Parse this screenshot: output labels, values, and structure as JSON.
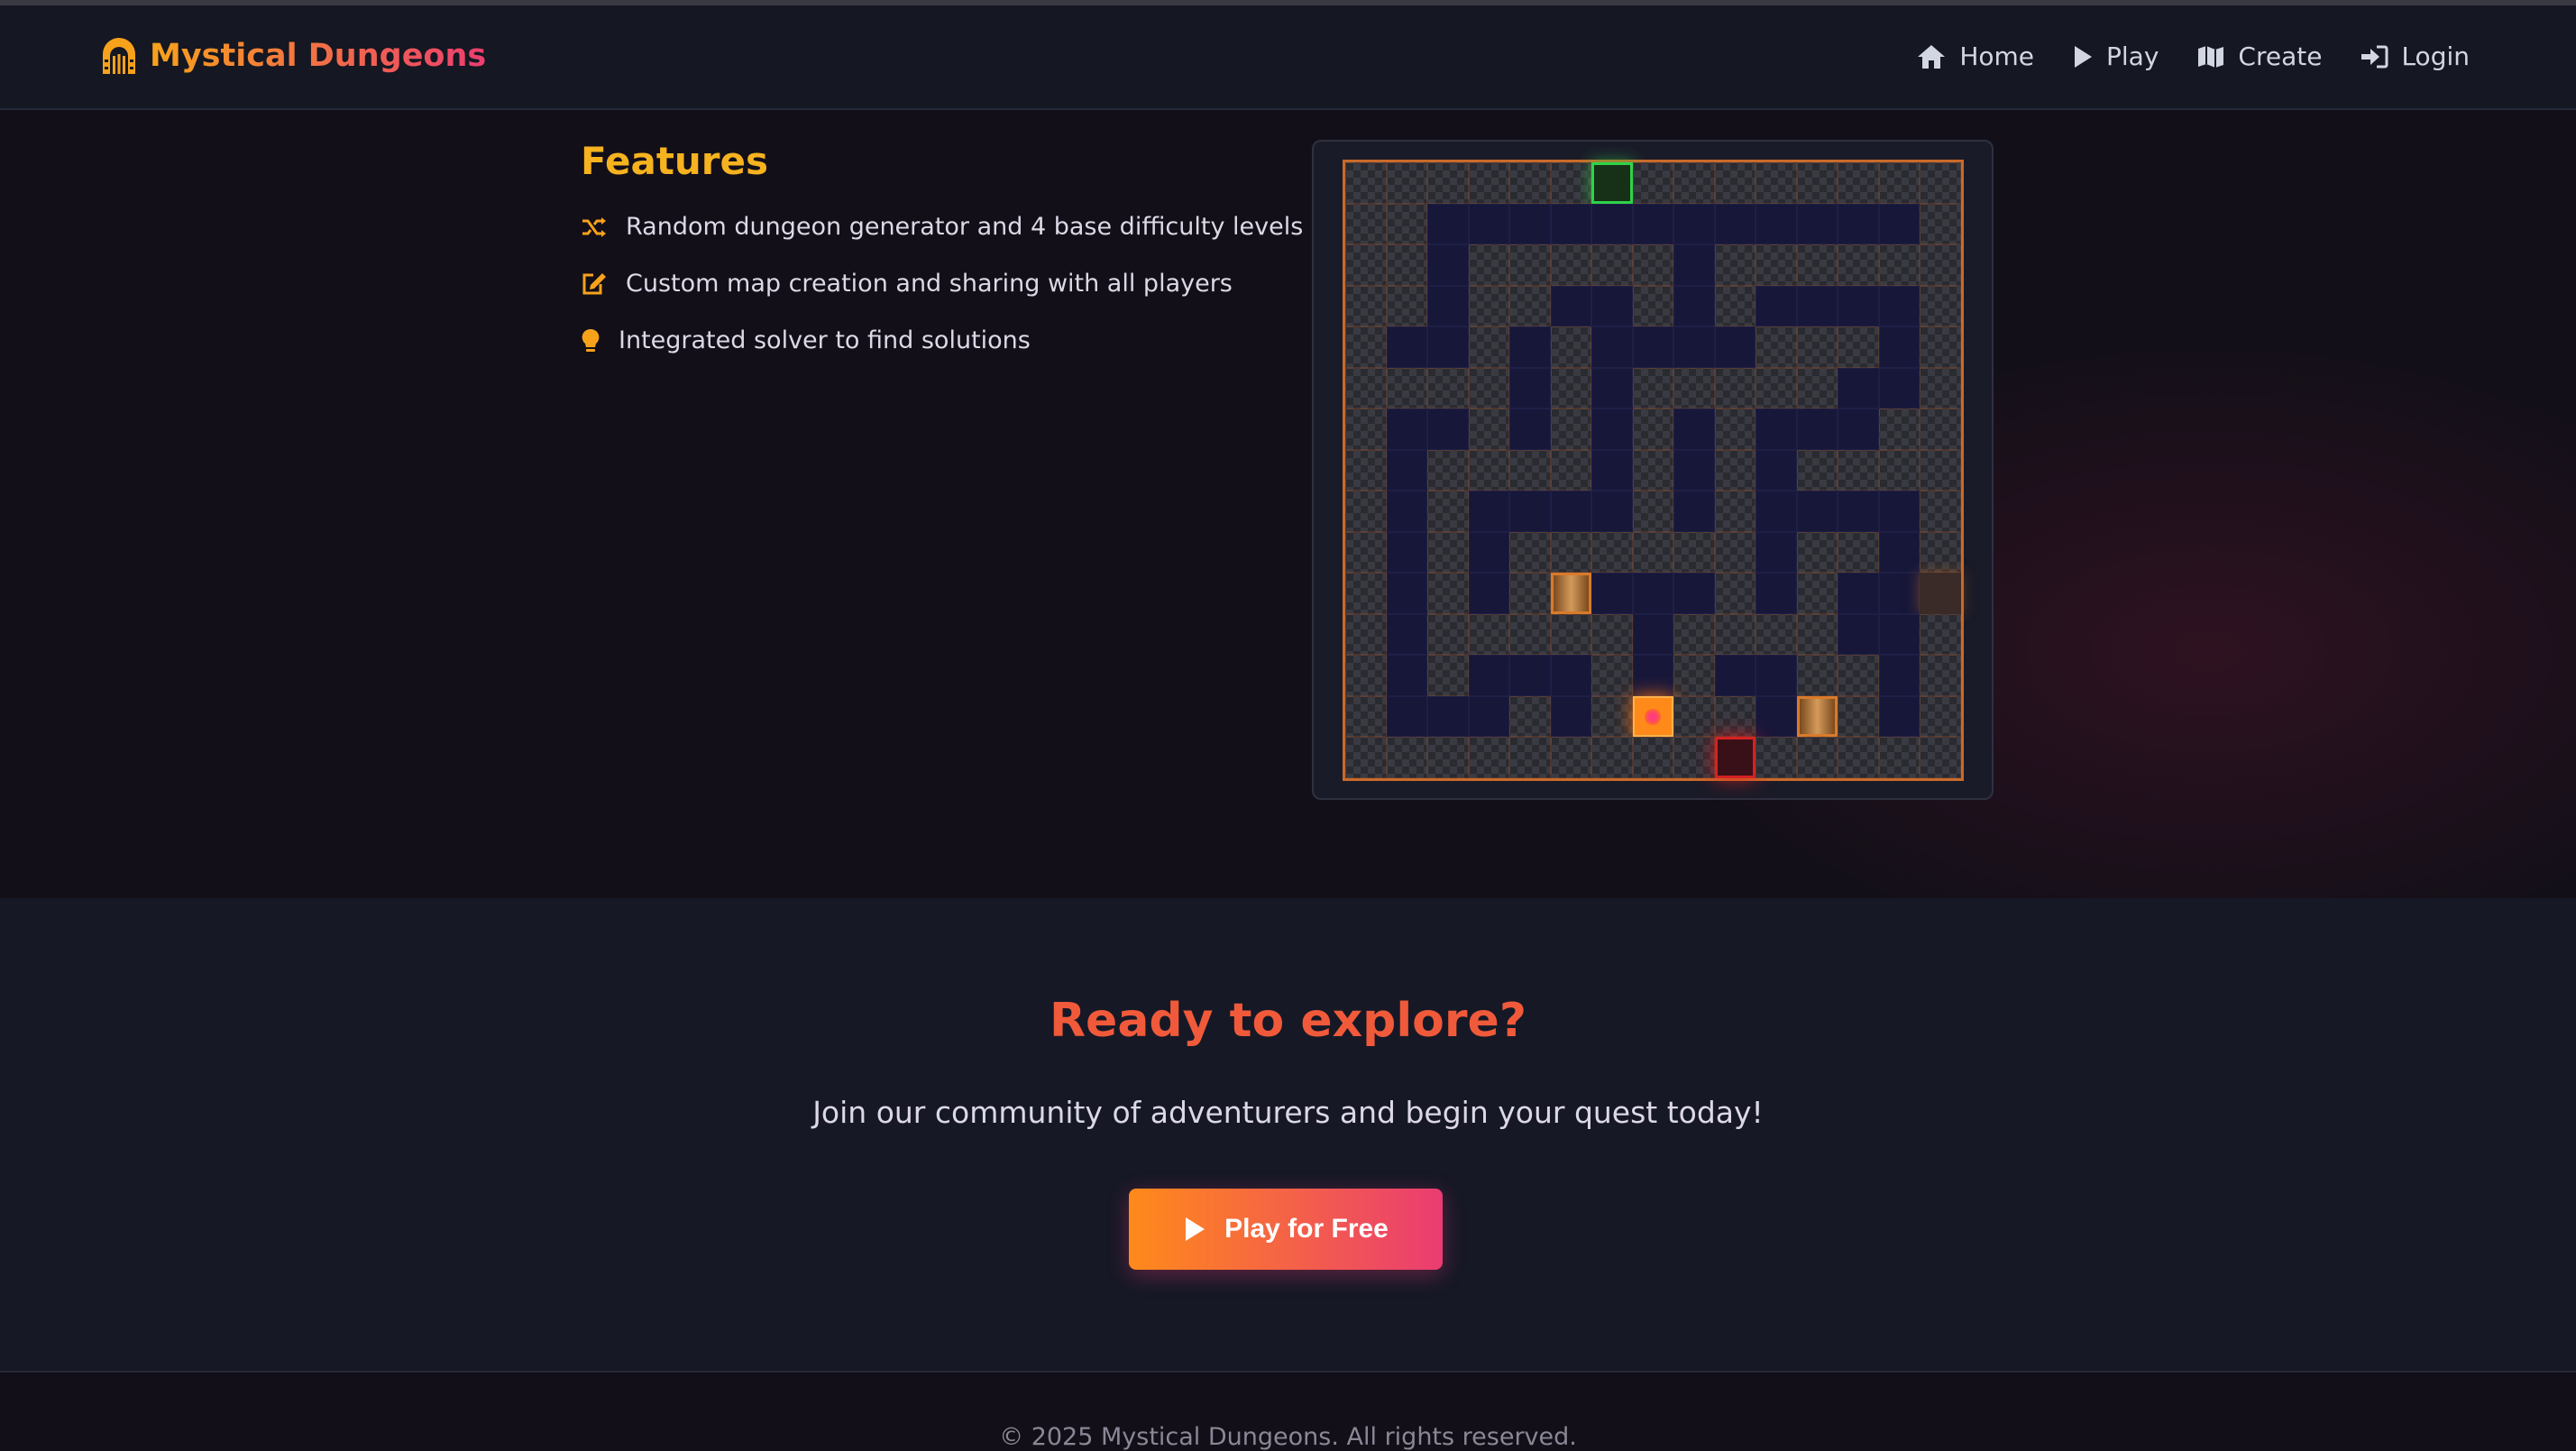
{
  "brand": {
    "name": "Mystical Dungeons",
    "icon": "dungeon-gate-icon",
    "gradient": [
      "#f7a21b",
      "#ec3e6f"
    ]
  },
  "nav": {
    "items": [
      {
        "label": "Home",
        "icon": "home-icon"
      },
      {
        "label": "Play",
        "icon": "play-icon"
      },
      {
        "label": "Create",
        "icon": "map-icon"
      },
      {
        "label": "Login",
        "icon": "login-icon"
      }
    ]
  },
  "features": {
    "title": "Features",
    "items": [
      {
        "text": "Random dungeon generator and 4 base difficulty levels",
        "icon": "shuffle-icon"
      },
      {
        "text": "Custom map creation and sharing with all players",
        "icon": "edit-icon"
      },
      {
        "text": "Integrated solver to find solutions",
        "icon": "lightbulb-icon"
      }
    ]
  },
  "map": {
    "legend": {
      "W": "wall",
      "F": "floor",
      "S": "start",
      "E": "exit",
      "P": "player",
      "C": "crate",
      "T": "trap"
    },
    "rows": [
      "WWWWWWSWWWWWWWW",
      "WWFFFFFFFFFFFFW",
      "WWFWWWWWFWWWWWW",
      "WWFWWFFWFWFFFFW",
      "WFFWFWFFFFWWWFW",
      "WWWWFWFWWWWWFFW",
      "WFFWFWFWFWFFFWW",
      "WFWWWWFWFWFWWWW",
      "WFWFFFFWFWFFFFW",
      "WFWFWWWWWWFWWFW",
      "WFWFWCFFFWFWFFT",
      "WFWWWWWFWWWWFFW",
      "WFWFFFWFWFFWWFW",
      "WFFFWFWPWWFCWFW",
      "WWWWWWWWWEWWWWW"
    ]
  },
  "cta": {
    "title": "Ready to explore?",
    "subtitle": "Join our community of adventurers and begin your quest today!",
    "button_label": "Play for Free",
    "button_icon": "play-icon",
    "gradient": [
      "#ff8a1a",
      "#ea3c72"
    ]
  },
  "footer": {
    "text": "© 2025 Mystical Dungeons. All rights reserved."
  }
}
